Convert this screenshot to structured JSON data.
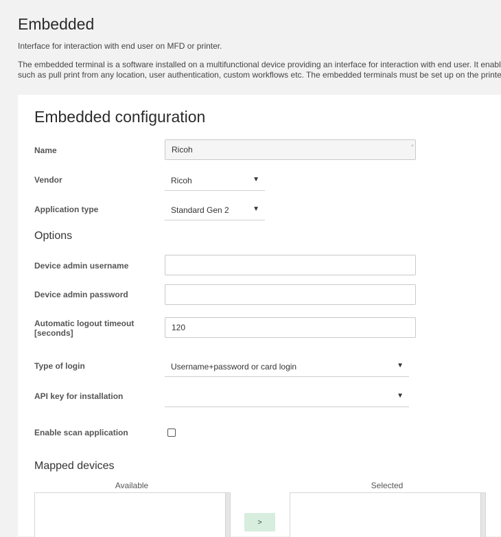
{
  "page": {
    "title": "Embedded",
    "intro": "Interface for interaction with end user on MFD or printer.",
    "description_line1": "The embedded terminal is a software installed on a multifunctional device providing an interface for interaction with end user. It enable",
    "description_line2": "such as pull print from any location, user authentication, custom workflows etc. The embedded terminals must be set up on the printer"
  },
  "form": {
    "title": "Embedded configuration",
    "name": {
      "label": "Name",
      "value": "Ricoh",
      "required_mark": "*"
    },
    "vendor": {
      "label": "Vendor",
      "value": "Ricoh"
    },
    "application_type": {
      "label": "Application type",
      "value": "Standard Gen 2"
    },
    "options_title": "Options",
    "admin_username": {
      "label": "Device admin username",
      "value": ""
    },
    "admin_password": {
      "label": "Device admin password",
      "value": ""
    },
    "logout_timeout": {
      "label_line1": "Automatic logout timeout",
      "label_line2": "[seconds]",
      "value": "120"
    },
    "login_type": {
      "label": "Type of login",
      "value": "Username+password or card login"
    },
    "api_key": {
      "label": "API key for installation",
      "value": ""
    },
    "scan_app": {
      "label": "Enable scan application",
      "checked": false
    },
    "mapped_devices": {
      "title": "Mapped devices",
      "available_label": "Available",
      "selected_label": "Selected",
      "move_label": ">"
    }
  },
  "icons": {
    "dropdown": "chevron-down-icon"
  },
  "colors": {
    "background": "#f2f2f2",
    "card": "#ffffff",
    "move_button": "#d7eedf"
  }
}
